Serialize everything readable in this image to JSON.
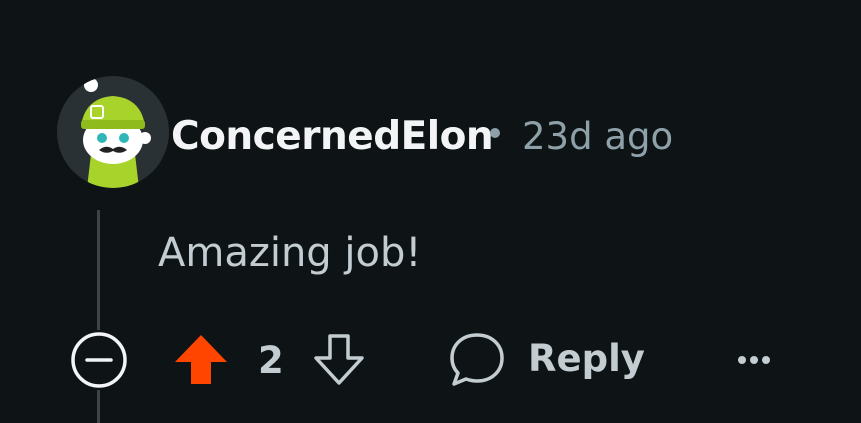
{
  "comment": {
    "username": "ConcernedElon",
    "separator": "•",
    "timestamp": "23d ago",
    "text": "Amazing job!",
    "vote_count": "2",
    "reply_label": "Reply"
  },
  "colors": {
    "background": "#0e1416",
    "username": "#f2f4f5",
    "meta": "#8ea0a8",
    "text": "#c3cdd1",
    "upvote_active": "#ff4500",
    "thread_line": "#3b4549"
  },
  "icons": {
    "avatar": "reddit-snoo-avatar",
    "collapse": "minus-circle-icon",
    "upvote": "upvote-arrow-icon",
    "downvote": "downvote-arrow-icon",
    "reply": "speech-bubble-icon",
    "more": "ellipsis-icon"
  }
}
